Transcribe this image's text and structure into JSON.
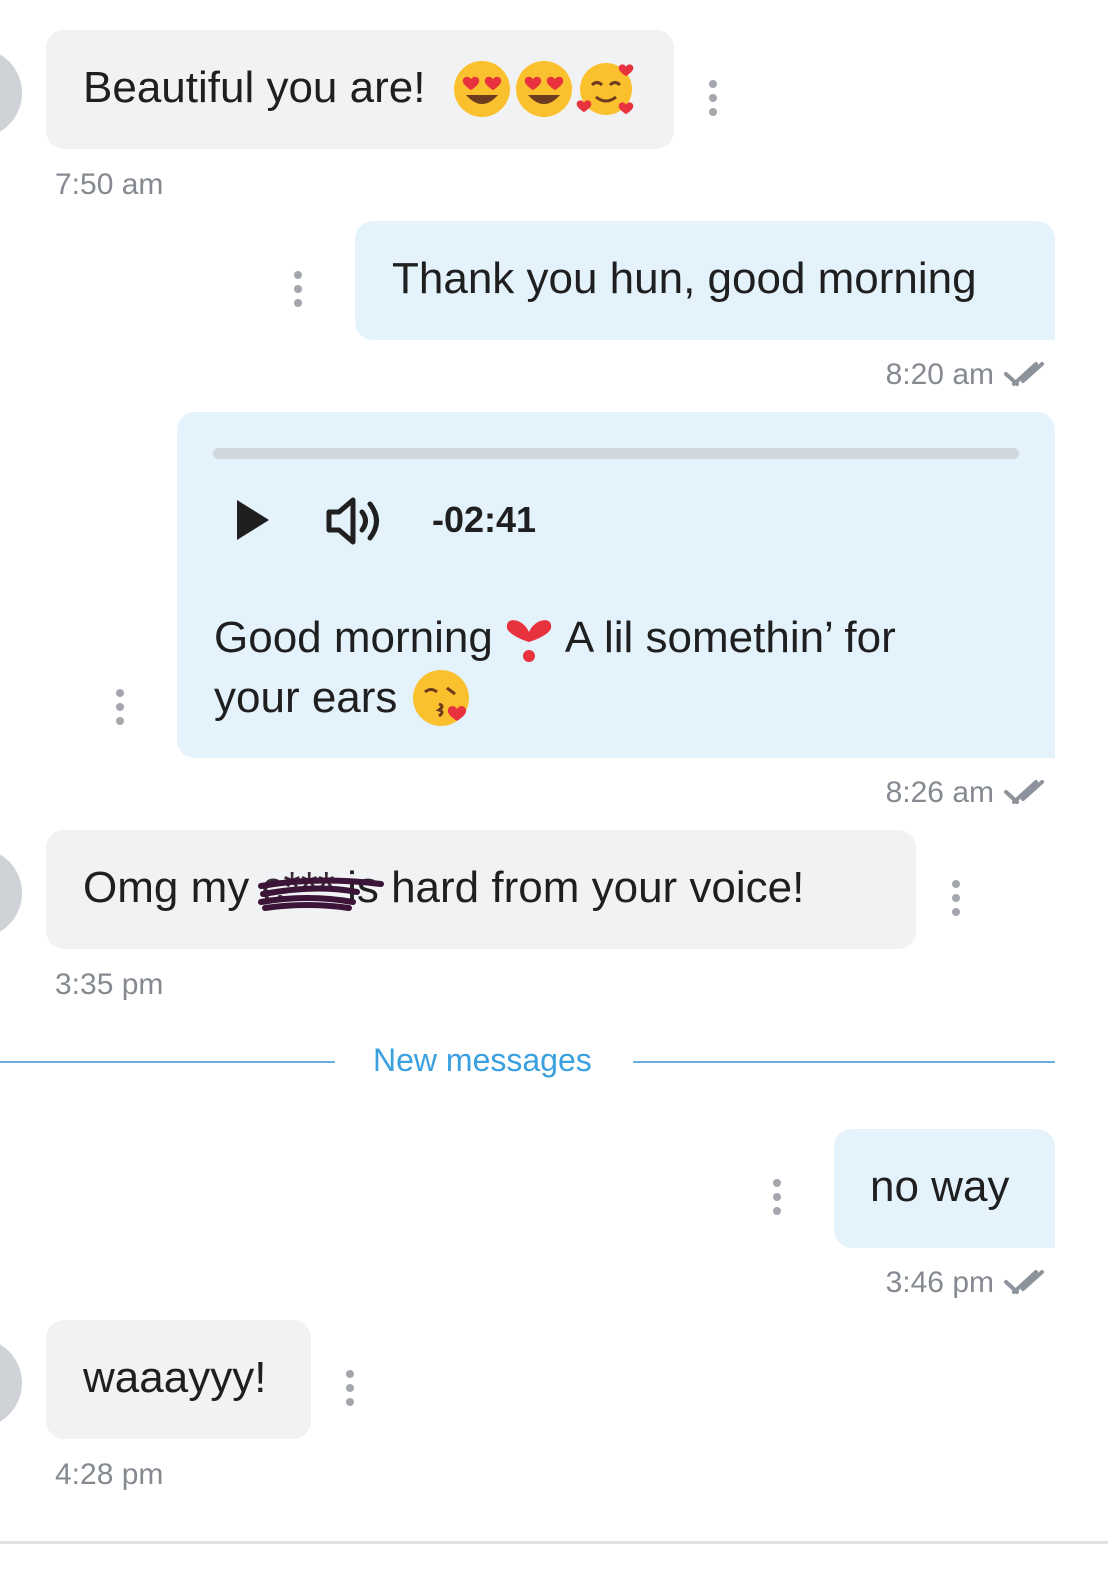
{
  "messages": [
    {
      "direction": "incoming",
      "text": "Beautiful you are!",
      "emojis": [
        "smiling-face-with-heart-eyes",
        "smiling-face-with-heart-eyes",
        "smiling-face-with-hearts"
      ],
      "time": "7:50 am"
    },
    {
      "direction": "outgoing",
      "text": "Thank you hun, good morning",
      "time": "8:20 am",
      "status": "read"
    },
    {
      "direction": "outgoing",
      "type": "voice",
      "audio": {
        "remaining": "-02:41",
        "progress": 0
      },
      "caption_1": "Good morning",
      "caption_2": "A lil somethin’ for",
      "caption_3": "your ears",
      "emojis": [
        "heavy-exclamation-heart",
        "face-blowing-kiss"
      ],
      "time": "8:26 am",
      "status": "read"
    },
    {
      "direction": "incoming",
      "text_before": "Omg my",
      "redacted": "c***",
      "text_after": "is hard from your voice!",
      "time": "3:35 pm"
    },
    {
      "direction": "outgoing",
      "text": "no way",
      "time": "3:46 pm",
      "status": "read"
    },
    {
      "direction": "incoming",
      "text": "waaayyy!",
      "time": "4:28 pm"
    }
  ],
  "divider": {
    "label": "New messages"
  },
  "colors": {
    "incoming_bubble": "#f1f2f4",
    "outgoing_bubble": "#e3f2fb",
    "divider": "#3ba0e0",
    "time": "#858a91"
  }
}
